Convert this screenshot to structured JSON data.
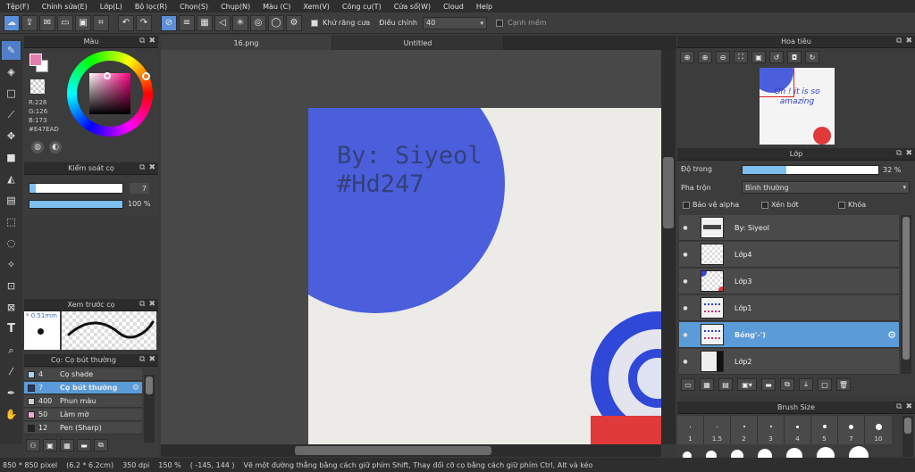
{
  "menu": [
    "Tệp(F)",
    "Chỉnh sửa(E)",
    "Lớp(L)",
    "Bộ lọc(R)",
    "Chọn(S)",
    "Chụp(N)",
    "Màu (C)",
    "Xem(V)",
    "Công cụ(T)",
    "Cửa sổ(W)",
    "Cloud",
    "Help"
  ],
  "toolbar": {
    "antialias_label": "Khử răng cưa",
    "correction_label": "Điều chỉnh",
    "correction_value": "40",
    "smooth_label": "Cạnh mềm"
  },
  "color_panel": {
    "title": "Màu",
    "r": "R:228",
    "g": "G:126",
    "b": "B:173",
    "hex": "#E47EAD",
    "fg_color": "#E47EAD"
  },
  "brush_control": {
    "title": "Kiểm soát cọ",
    "size_value": "7",
    "opacity_value": "100 %",
    "size_fraction": 0.07,
    "opacity_fraction": 1.0
  },
  "brush_preview": {
    "title": "Xem trước cọ",
    "size_label": "* 0.51mm"
  },
  "brush_list": {
    "title": "Cọ: Cọ bút thường",
    "items": [
      {
        "size": "4",
        "name": "Cọ shade",
        "color": "#a7d5f0"
      },
      {
        "size": "7",
        "name": "Cọ bút thường",
        "color": "#1e3d6e"
      },
      {
        "size": "400",
        "name": "Phun màu",
        "color": "#d0d0d0"
      },
      {
        "size": "50",
        "name": "Làm mờ",
        "color": "#f0a8d8"
      },
      {
        "size": "12",
        "name": "Pen (Sharp)",
        "color": "#222222"
      }
    ]
  },
  "tabs": [
    "16.png",
    "Untitled"
  ],
  "canvas": {
    "text_line1": "By: Siyeol",
    "text_line2": "#Hd247",
    "circle_color": "#4b5fdc",
    "paper_color": "#ecebe8"
  },
  "navigator": {
    "title": "Hoa tiêu",
    "preview_text": "Oh ! it is so amazing"
  },
  "layers": {
    "title": "Lớp",
    "opacity_label": "Độ trong",
    "opacity_value": "32 %",
    "opacity_fraction": 0.32,
    "blend_label": "Pha trộn",
    "blend_value": "Bình thường",
    "protect_alpha": "Bảo vệ alpha",
    "clipping": "Xén bớt",
    "lock": "Khóa",
    "items": [
      {
        "name": "By: Siyeol",
        "selected": false
      },
      {
        "name": "Lớp4",
        "selected": false
      },
      {
        "name": "Lớp3",
        "selected": false
      },
      {
        "name": "Lớp1",
        "selected": false
      },
      {
        "name": "Bóng'-')",
        "selected": true
      },
      {
        "name": "Lớp2",
        "selected": false
      }
    ]
  },
  "brush_size": {
    "title": "Brush Size",
    "sizes": [
      "1",
      "1.5",
      "2",
      "3",
      "4",
      "5",
      "7",
      "10"
    ]
  },
  "status": {
    "dimensions": "850 * 850 pixel",
    "physical": "(6.2 * 6.2cm)",
    "dpi": "350 dpi",
    "zoom": "150 %",
    "coords": "( -145, 144 )",
    "hint": "Vẽ một đường thẳng bằng cách giữ phím Shift, Thay đổi cỡ cọ bằng cách giữ phím Ctrl, Alt và kéo"
  }
}
